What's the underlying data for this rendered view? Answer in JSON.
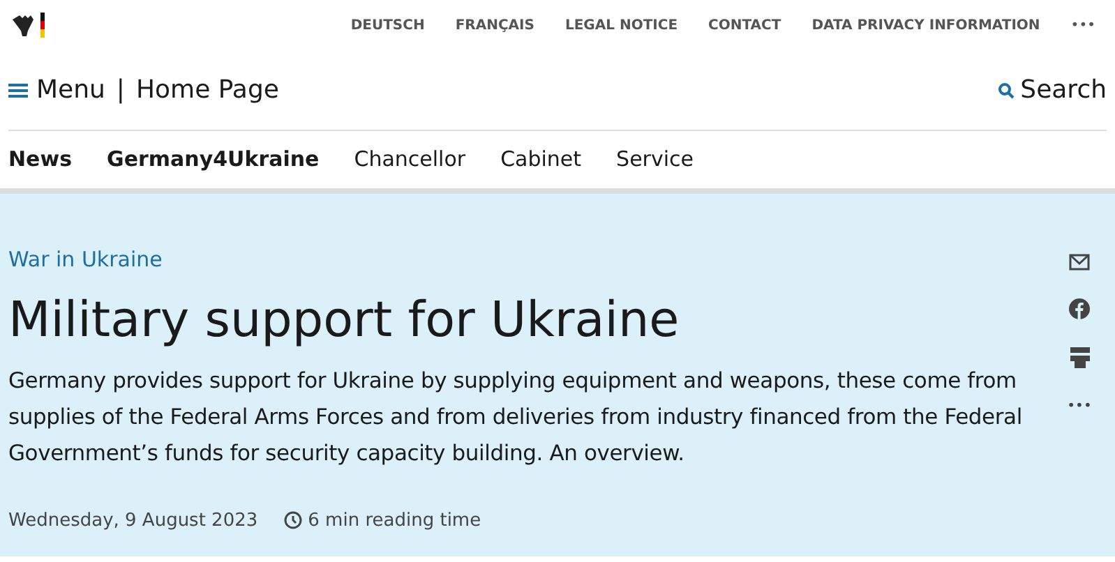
{
  "top_links": [
    "DEUTSCH",
    "FRANÇAIS",
    "LEGAL NOTICE",
    "CONTACT",
    "DATA PRIVACY INFORMATION"
  ],
  "more_label": "•••",
  "header": {
    "menu": "Menu",
    "separator": "|",
    "home": "Home Page",
    "search": "Search"
  },
  "nav": [
    {
      "label": "News",
      "bold": true
    },
    {
      "label": "Germany4Ukraine",
      "bold": true
    },
    {
      "label": "Chancellor",
      "bold": false
    },
    {
      "label": "Cabinet",
      "bold": false
    },
    {
      "label": "Service",
      "bold": false
    }
  ],
  "article": {
    "category": "War in Ukraine",
    "title": "Military support for Ukraine",
    "lead": "Germany provides support for Ukraine by supplying equipment and weapons, these come from supplies of the Federal Arms Forces and from deliveries from industry financed from the Federal Government’s funds for security capacity building. An overview.",
    "date": "Wednesday, 9 August 2023",
    "reading_time": "6 min reading time"
  },
  "share": [
    {
      "kind": "mail"
    },
    {
      "kind": "facebook"
    },
    {
      "kind": "print"
    },
    {
      "kind": "more",
      "label": "•••"
    }
  ]
}
